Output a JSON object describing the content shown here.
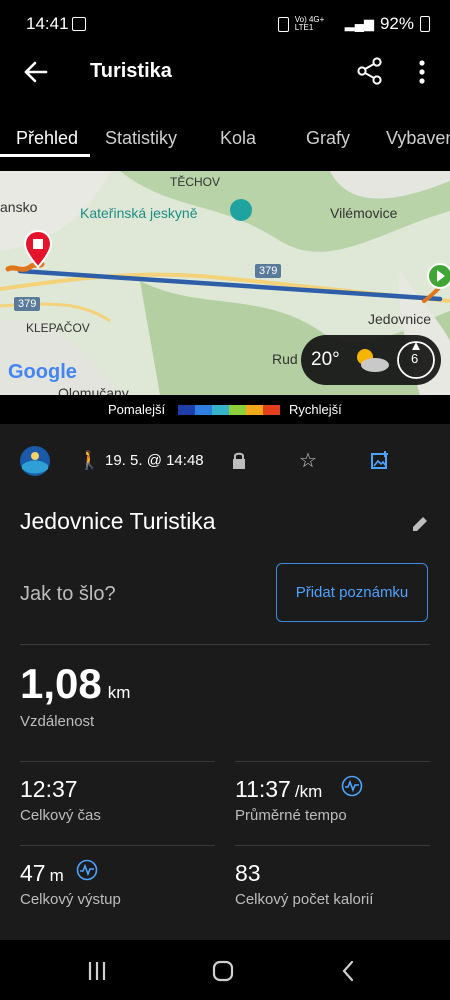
{
  "status": {
    "time": "14:41",
    "battery": "92%",
    "net": "Vo) 4G+ LTE1"
  },
  "app": {
    "title": "Turistika"
  },
  "tabs": [
    "Přehled",
    "Statistiky",
    "Kola",
    "Grafy",
    "Vybavení"
  ],
  "map": {
    "labels": {
      "techov": "TĚCHOV",
      "ansko": "ansko",
      "katerinska": "Kateřinská jeskyně",
      "vilemovice": "Vilémovice",
      "klepacov": "KLEPAČOV",
      "jedovnice": "Jedovnice",
      "rud": "Rud",
      "olomucany": "Olomučany",
      "road": "379"
    },
    "google": "Google",
    "weather": {
      "temp": "20°",
      "wind": "6"
    }
  },
  "legend": {
    "slower": "Pomalejší",
    "faster": "Rychlejší"
  },
  "meta": {
    "date": "19. 5. @ 14:48"
  },
  "activity": {
    "title": "Jedovnice Turistika"
  },
  "note": {
    "question": "Jak to šlo?",
    "button": "Přidat poznámku"
  },
  "stats": {
    "distance": {
      "value": "1,08",
      "unit": "km",
      "label": "Vzdálenost"
    },
    "total_time": {
      "value": "12:37",
      "label": "Celkový čas"
    },
    "pace": {
      "value": "11:37",
      "unit": "/km",
      "label": "Průměrné tempo"
    },
    "ascent": {
      "value": "47",
      "unit": "m",
      "label": "Celkový výstup"
    },
    "calories": {
      "value": "83",
      "label": "Celkový počet kalorií"
    }
  },
  "colors": {
    "accent": "#4da3ff",
    "pin": "#e5142d",
    "start": "#3fa535"
  }
}
